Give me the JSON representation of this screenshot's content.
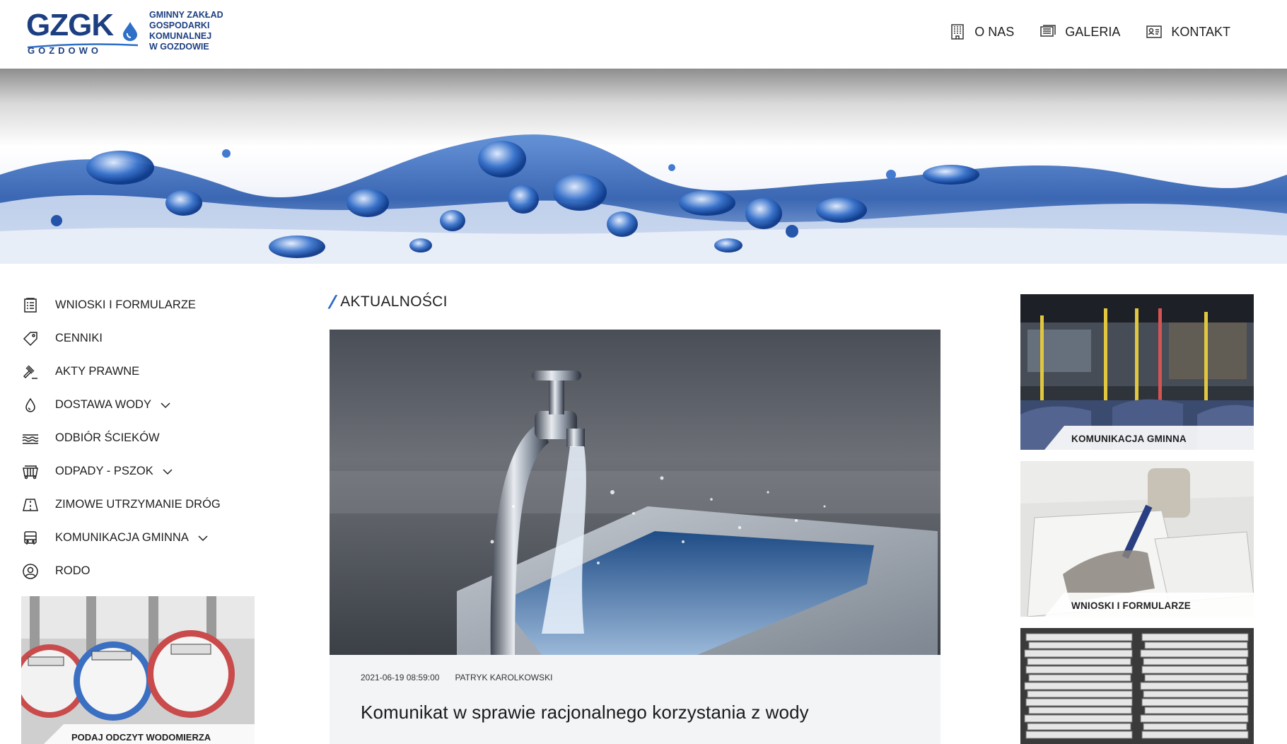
{
  "header": {
    "logo": {
      "mark": "GZGK",
      "sub": "GOZDOWO",
      "name_lines": [
        "GMINNY ZAKŁAD",
        "GOSPODARKI",
        "KOMUNALNEJ",
        "W GOZDOWIE"
      ]
    },
    "nav": [
      {
        "label": "O NAS",
        "icon": "building-icon"
      },
      {
        "label": "GALERIA",
        "icon": "gallery-icon"
      },
      {
        "label": "KONTAKT",
        "icon": "contact-card-icon"
      }
    ]
  },
  "sidebar": {
    "items": [
      {
        "label": "WNIOSKI I FORMULARZE",
        "icon": "form-list-icon",
        "has_submenu": false
      },
      {
        "label": "CENNIKI",
        "icon": "price-tag-icon",
        "has_submenu": false
      },
      {
        "label": "AKTY PRAWNE",
        "icon": "gavel-icon",
        "has_submenu": false
      },
      {
        "label": "DOSTAWA WODY",
        "icon": "water-drop-icon",
        "has_submenu": true
      },
      {
        "label": "ODBIÓR ŚCIEKÓW",
        "icon": "waves-icon",
        "has_submenu": false
      },
      {
        "label": "ODPADY - PSZOK",
        "icon": "container-icon",
        "has_submenu": true
      },
      {
        "label": "ZIMOWE UTRZYMANIE DRÓG",
        "icon": "road-icon",
        "has_submenu": false
      },
      {
        "label": "KOMUNIKACJA GMINNA",
        "icon": "bus-icon",
        "has_submenu": true
      },
      {
        "label": "RODO",
        "icon": "user-circle-icon",
        "has_submenu": false
      }
    ],
    "card": {
      "label": "PODAJ ODCZYT WODOMIERZA"
    }
  },
  "main": {
    "section_title": "AKTUALNOŚCI",
    "article": {
      "date": "2021-06-19 08:59:00",
      "author": "PATRYK KAROLKOWSKI",
      "title": "Komunikat w sprawie racjonalnego korzystania z wody"
    }
  },
  "right": {
    "cards": [
      {
        "label": "KOMUNIKACJA GMINNA"
      },
      {
        "label": "WNIOSKI I FORMULARZE"
      },
      {
        "label": ""
      }
    ]
  },
  "colors": {
    "brand": "#1d3f82",
    "accent": "#2a69c4",
    "article_bg": "#f3f4f6"
  }
}
